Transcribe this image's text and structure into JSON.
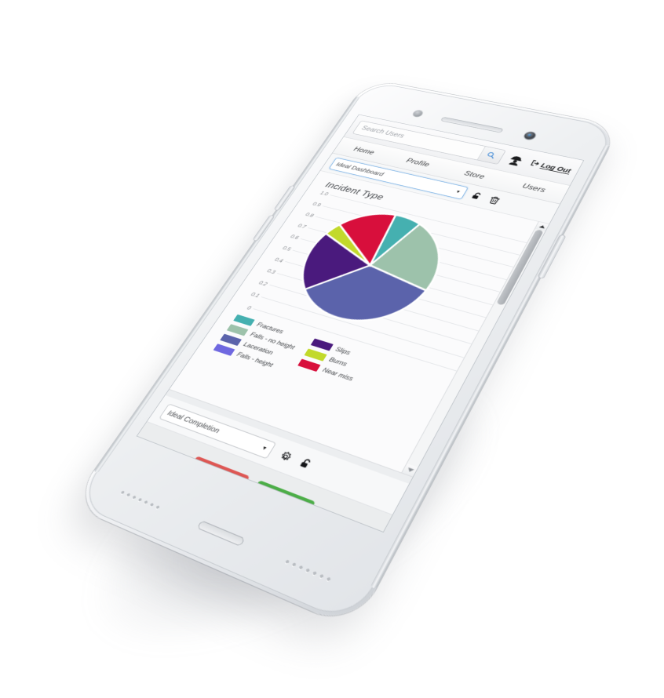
{
  "device": {
    "name": "white-smartphone-mockup",
    "hardware": {
      "sensor": "proximity-sensor",
      "earpiece": "earpiece-speaker",
      "camera": "front-camera",
      "power_button": "power-button",
      "volume_up": "volume-up-button",
      "volume_down": "volume-down-button",
      "lightning_port": "charging-port",
      "speaker_grille": "speaker-grille"
    }
  },
  "header": {
    "search": {
      "placeholder": "Search Users",
      "value": "",
      "icon": "search-icon"
    },
    "user_icon": "hard-hat-user-icon",
    "logout_label": "Log Out",
    "logout_icon": "logout-arrow-icon"
  },
  "nav": {
    "items": [
      {
        "label": "Home"
      },
      {
        "label": "Profile"
      },
      {
        "label": "Store"
      },
      {
        "label": "Users"
      }
    ]
  },
  "dashboard_toolbar": {
    "select_value": "Ideal Dashboard",
    "caret_icon": "chevron-down-icon",
    "unlock_icon": "unlock-icon",
    "delete_icon": "trash-icon"
  },
  "scrollbar": {
    "up_icon": "chevron-up-icon",
    "down_icon": "chevron-down-icon"
  },
  "bottom_widget": {
    "select_value": "Ideal Completion",
    "caret_icon": "chevron-down-icon",
    "settings_icon": "gear-icon",
    "unlock_icon": "unlock-icon",
    "buttons": [
      {
        "name": "red-status-button",
        "color": "#cf4542"
      },
      {
        "name": "green-status-button",
        "color": "#38a037"
      }
    ]
  },
  "chart_data": {
    "type": "pie",
    "title": "Incident Type",
    "xlabel": "",
    "ylabel": "",
    "ylim": [
      0,
      1.0
    ],
    "grid": true,
    "legend_position": "bottom",
    "ytick_labels": [
      "1.0",
      "0.9",
      "0.8",
      "0.7",
      "0.6",
      "0.5",
      "0.4",
      "0.3",
      "0.2",
      "0.1",
      "0"
    ],
    "ytick_values": [
      1.0,
      0.9,
      0.8,
      0.7,
      0.6,
      0.5,
      0.4,
      0.3,
      0.2,
      0.1,
      0
    ],
    "categories": [
      "Fractures",
      "Falls - no height",
      "Laceration",
      "Falls - height",
      "Slips",
      "Burns",
      "Near miss"
    ],
    "values": [
      7,
      22,
      35,
      0,
      18,
      4,
      14
    ],
    "colors": [
      "#45b0b0",
      "#9dc2ab",
      "#5b63ab",
      "#6f68e0",
      "#4a1a7d",
      "#c2d92b",
      "#d80f3c"
    ],
    "legend": [
      {
        "label": "Fractures",
        "color": "#45b0b0"
      },
      {
        "label": "Falls - no height",
        "color": "#9dc2ab"
      },
      {
        "label": "Laceration",
        "color": "#5b63ab"
      },
      {
        "label": "Falls - height",
        "color": "#6f68e0"
      },
      {
        "label": "Slips",
        "color": "#4a1a7d"
      },
      {
        "label": "Burns",
        "color": "#c2d92b"
      },
      {
        "label": "Near miss",
        "color": "#d80f3c"
      }
    ]
  }
}
